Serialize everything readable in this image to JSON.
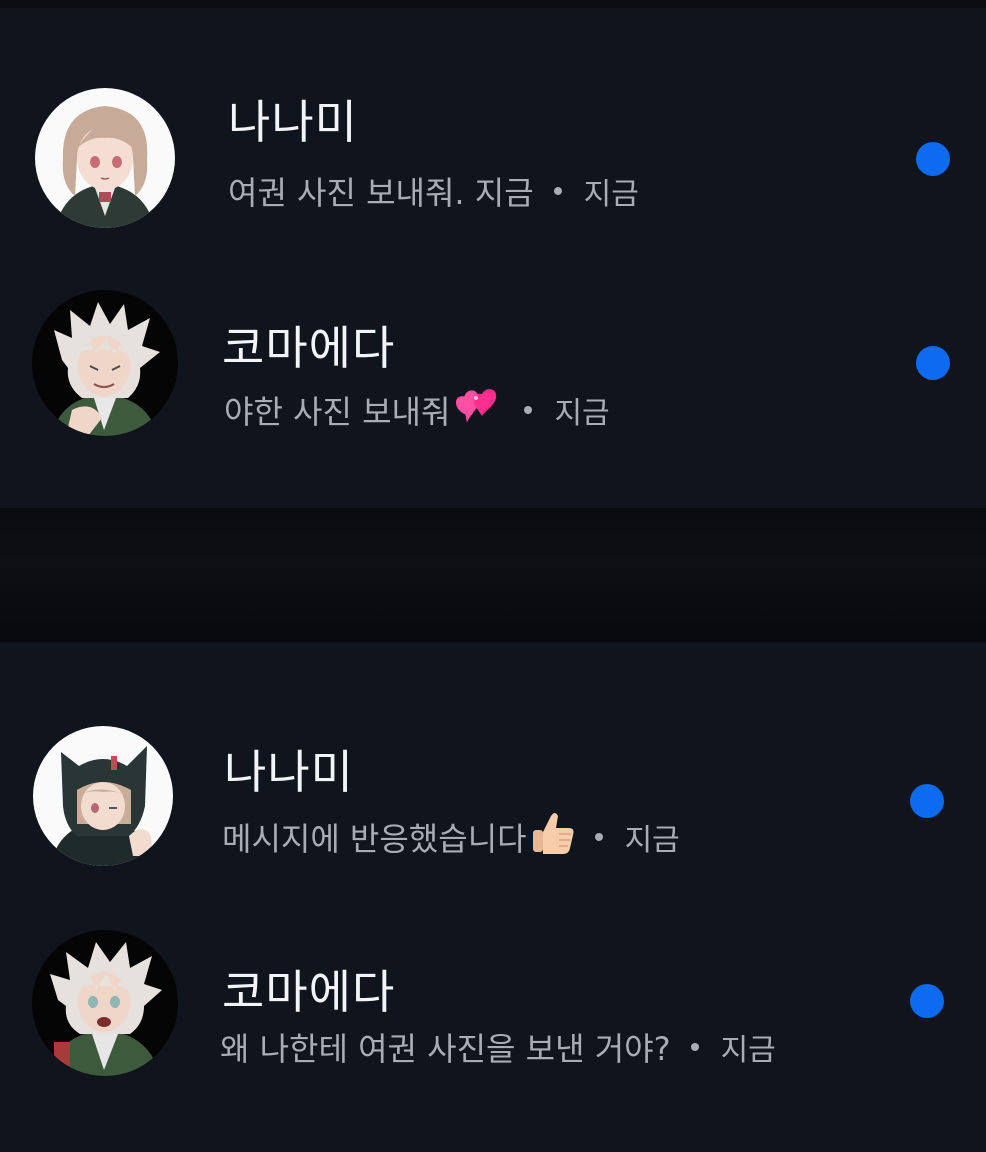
{
  "conversations": [
    {
      "name": "나나미",
      "message": "여권 사진 보내줘. 지금",
      "time": "지금",
      "emoji": "",
      "unread": true,
      "avatar_icon": "avatar-girl-brown-hair"
    },
    {
      "name": "코마에다",
      "message": "야한 사진 보내줘",
      "time": "지금",
      "emoji": "two-hearts-emoji",
      "unread": true,
      "avatar_icon": "avatar-boy-white-hair"
    },
    {
      "name": "나나미",
      "message": "메시지에 반응했습니다",
      "time": "지금",
      "emoji": "thumbs-up-emoji",
      "unread": true,
      "avatar_icon": "avatar-girl-cat-hoodie"
    },
    {
      "name": "코마에다",
      "message": "왜 나한테 여권 사진을 보낸 거야?",
      "time": "지금",
      "emoji": "",
      "unread": true,
      "avatar_icon": "avatar-boy-white-hair-shouting"
    }
  ],
  "colors": {
    "background": "#10141c",
    "unread_dot": "#0d6bf0",
    "name_text": "#f2f4f7",
    "preview_text": "#a7acb5"
  }
}
